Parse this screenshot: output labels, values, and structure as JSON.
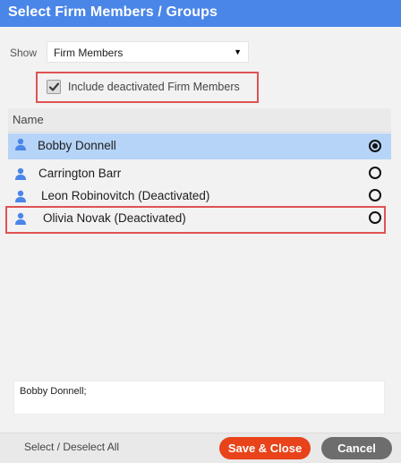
{
  "dialog": {
    "title": "Select Firm Members / Groups"
  },
  "show_filter": {
    "label": "Show",
    "selected": "Firm Members"
  },
  "include_deactivated": {
    "label": "Include deactivated Firm Members",
    "checked": true
  },
  "list": {
    "header": "Name",
    "rows": [
      {
        "name": "Bobby Donnell",
        "selected": true,
        "icon": "person-icon"
      },
      {
        "name": "Carrington Barr",
        "selected": false,
        "icon": "person-icon"
      },
      {
        "name": "Leon Robinovitch (Deactivated)",
        "selected": false,
        "icon": "person-icon"
      },
      {
        "name": "Olivia Novak (Deactivated)",
        "selected": false,
        "icon": "person-icon"
      }
    ]
  },
  "summary": {
    "text": "Bobby Donnell;"
  },
  "footer": {
    "select_all_label": "Select / Deselect All",
    "save_label": "Save & Close",
    "cancel_label": "Cancel"
  },
  "colors": {
    "title_bar": "#4a86e8",
    "selected_row": "#b6d4f7",
    "highlight_border": "#e05252",
    "save_button": "#e8431a",
    "cancel_button": "#6d6d6d",
    "person_icon": "#4a86e8"
  }
}
